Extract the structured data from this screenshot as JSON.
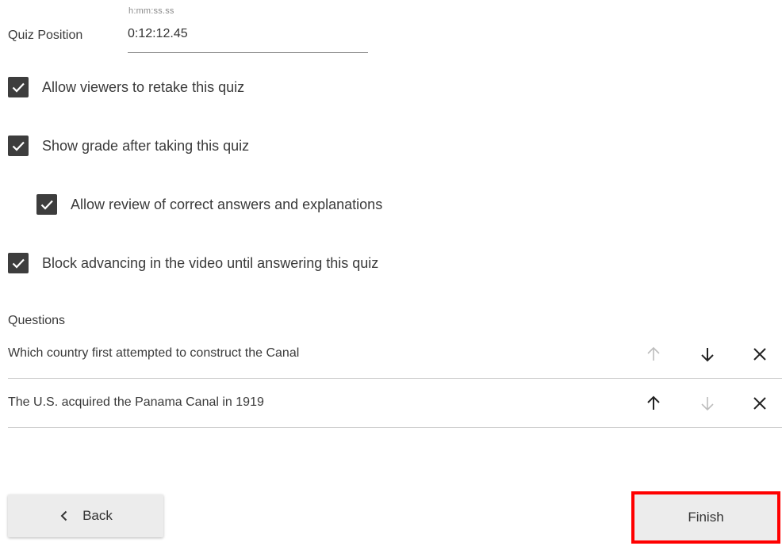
{
  "quiz_position": {
    "label": "Quiz Position",
    "hint": "h:mm:ss.ss",
    "value": "0:12:12.45"
  },
  "options": [
    {
      "label": "Allow viewers to retake this quiz",
      "checked": true
    },
    {
      "label": "Show grade after taking this quiz",
      "checked": true
    },
    {
      "label": "Allow review of correct answers and explanations",
      "checked": true
    },
    {
      "label": "Block advancing in the video until answering this quiz",
      "checked": true
    }
  ],
  "questions": {
    "heading": "Questions",
    "items": [
      {
        "text": "Which country first attempted to construct the Canal",
        "can_move_up": false,
        "can_move_down": true
      },
      {
        "text": "The U.S. acquired the Panama Canal in 1919",
        "can_move_up": true,
        "can_move_down": false
      }
    ]
  },
  "footer": {
    "back_label": "Back",
    "finish_label": "Finish"
  },
  "colors": {
    "checkbox": "#3d3d3d",
    "icon_active": "#222222",
    "icon_disabled": "#bdbdbd",
    "highlight": "#ff0000"
  }
}
